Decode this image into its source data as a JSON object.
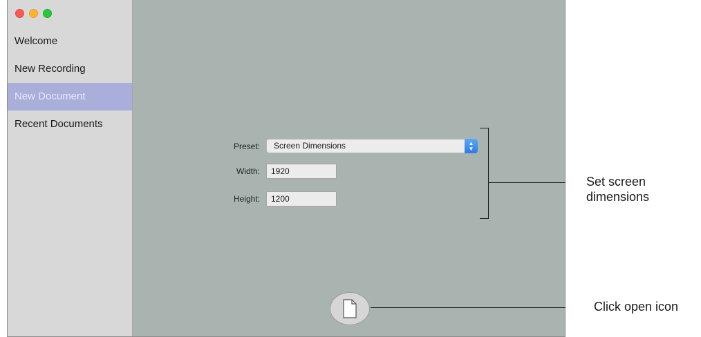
{
  "sidebar": {
    "items": [
      {
        "label": "Welcome"
      },
      {
        "label": "New Recording"
      },
      {
        "label": "New Document",
        "active": true
      },
      {
        "label": "Recent Documents"
      }
    ]
  },
  "form": {
    "preset_label": "Preset:",
    "preset_value": "Screen Dimensions",
    "width_label": "Width:",
    "width_value": "1920",
    "height_label": "Height:",
    "height_value": "1200"
  },
  "icons": {
    "open": "document-icon",
    "select": "up-down-chevron-icon"
  },
  "callouts": {
    "dimensions_line1": "Set screen",
    "dimensions_line2": "dimensions",
    "open": "Click open icon"
  },
  "colors": {
    "window_bg": "#a9b4b1",
    "sidebar_bg": "#d8d8d8",
    "active_item": "#a9aedb",
    "select_accent": "#2e7be4"
  }
}
